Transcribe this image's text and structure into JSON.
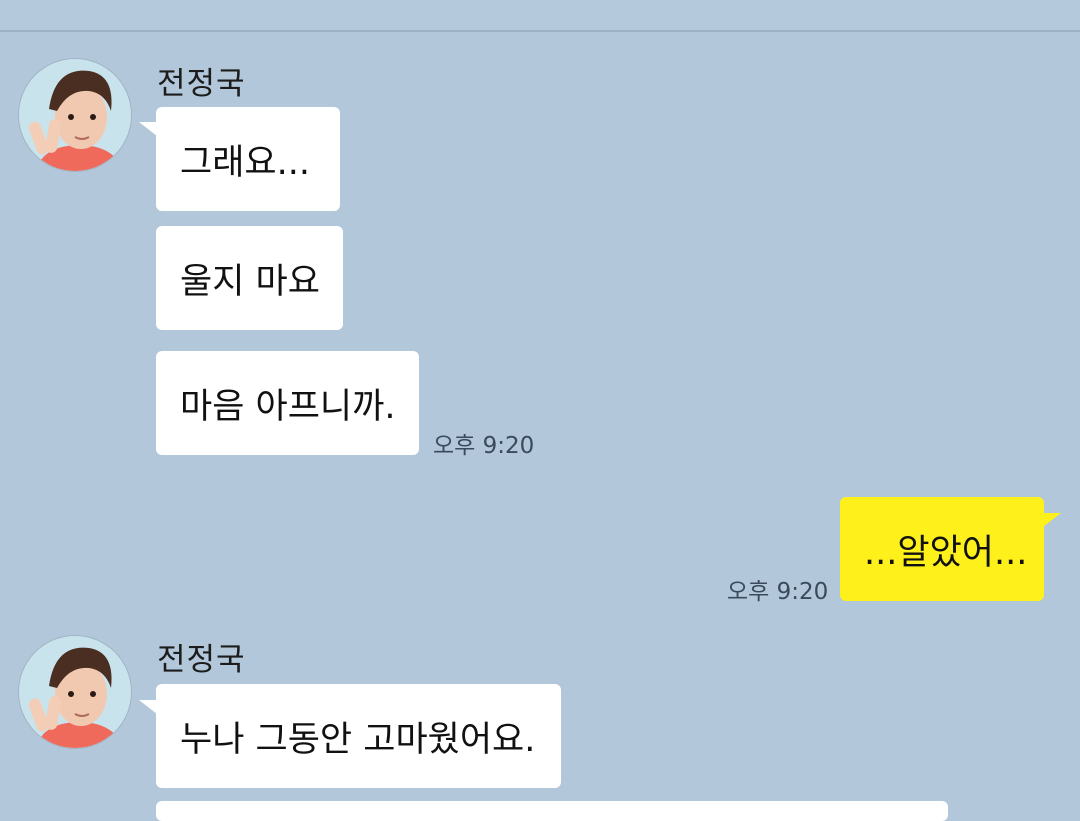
{
  "chat": {
    "messages": [
      {
        "sender": "전정국",
        "bubbles": [
          "그래요...",
          "울지 마요",
          "마음 아프니까."
        ],
        "time": "오후 9:20"
      },
      {
        "outgoing": "...알았어...",
        "time": "오후 9:20"
      },
      {
        "sender": "전정국",
        "bubbles": [
          "누나 그동안 고마웠어요."
        ]
      }
    ]
  },
  "colors": {
    "background": "#b2c7da",
    "incoming_bubble": "#ffffff",
    "outgoing_bubble": "#fef01b"
  },
  "icons": {
    "avatar": "profile-photo"
  }
}
